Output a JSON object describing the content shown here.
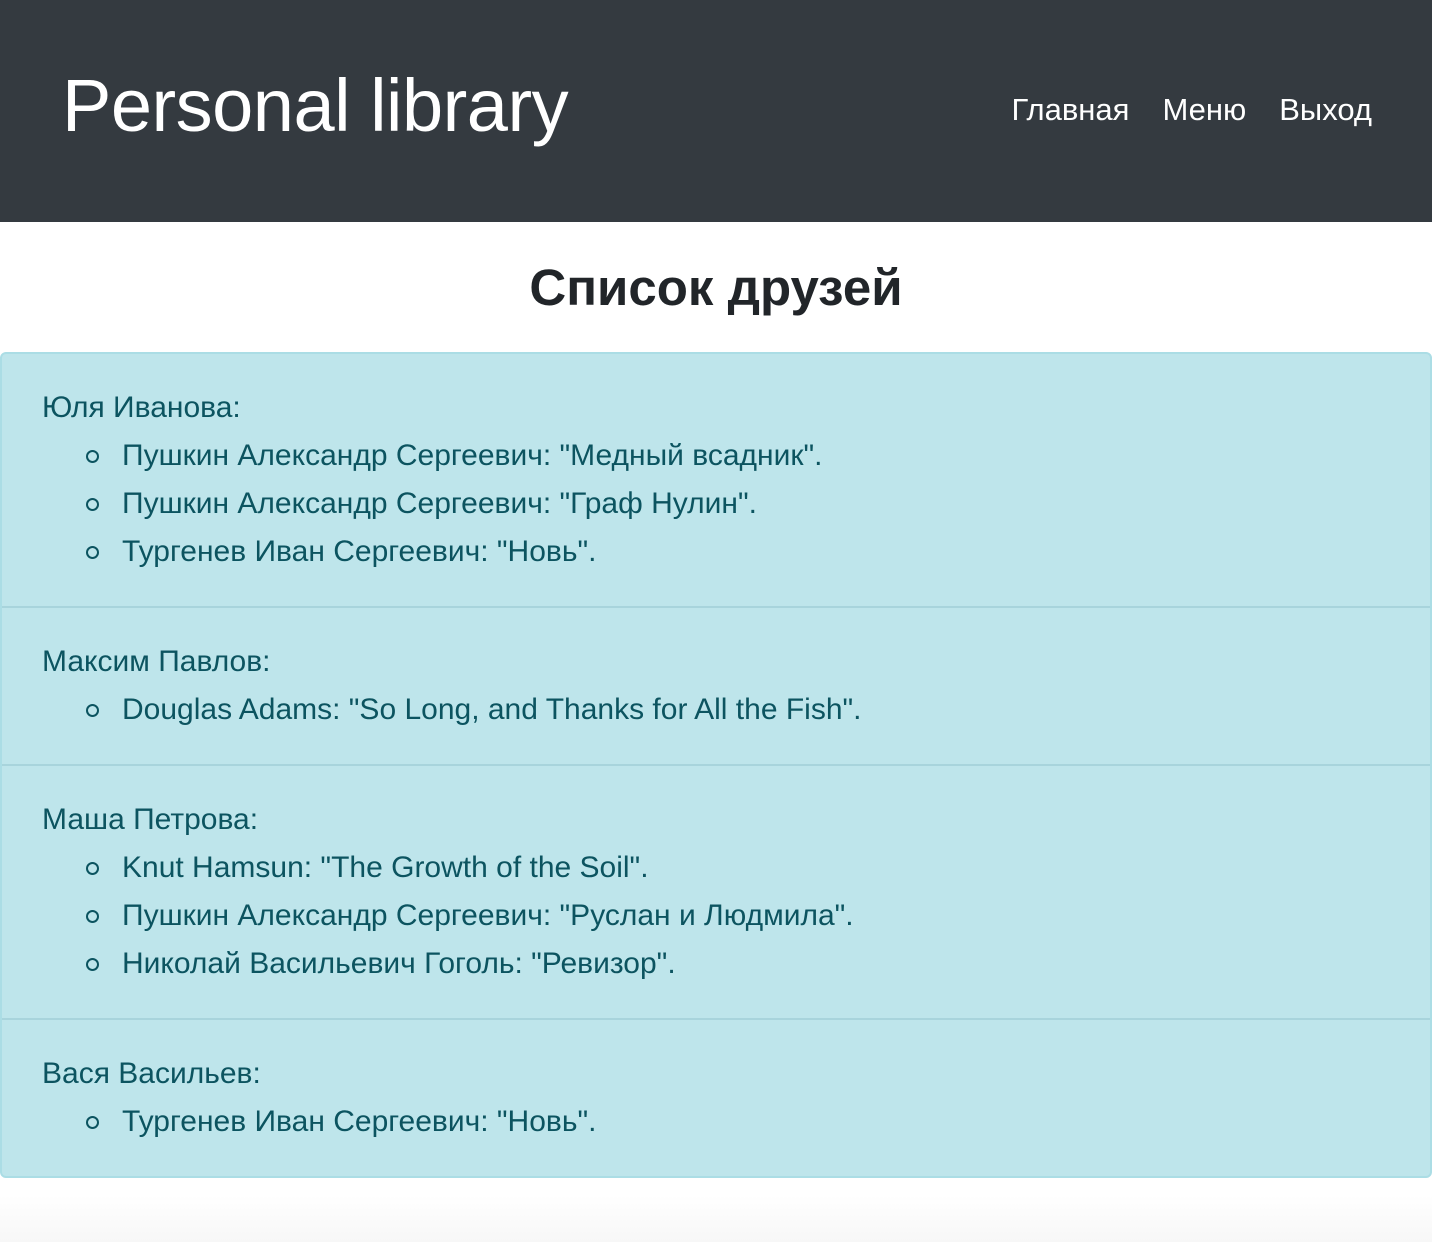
{
  "header": {
    "brand": "Personal library",
    "nav": [
      {
        "label": "Главная"
      },
      {
        "label": "Меню"
      },
      {
        "label": "Выход"
      }
    ]
  },
  "main": {
    "title": "Список друзей",
    "friends": [
      {
        "name": "Юля Иванова:",
        "books": [
          "Пушкин Александр Сергеевич: \"Медный всадник\".",
          "Пушкин Александр Сергеевич: \"Граф Нулин\".",
          "Тургенев Иван Сергеевич: \"Новь\"."
        ]
      },
      {
        "name": "Максим Павлов:",
        "books": [
          "Douglas Adams: \"So Long, and Thanks for All the Fish\"."
        ]
      },
      {
        "name": "Маша Петрова:",
        "books": [
          "Knut Hamsun: \"The Growth of the Soil\".",
          "Пушкин Александр Сергеевич: \"Руслан и Людмила\".",
          "Николай Васильевич Гоголь: \"Ревизор\"."
        ]
      },
      {
        "name": "Вася Васильев:",
        "books": [
          "Тургенев Иван Сергеевич: \"Новь\"."
        ]
      }
    ]
  },
  "colors": {
    "navbar": "#343a40",
    "panel": "#bee5eb",
    "panel_text": "#0c5460"
  }
}
